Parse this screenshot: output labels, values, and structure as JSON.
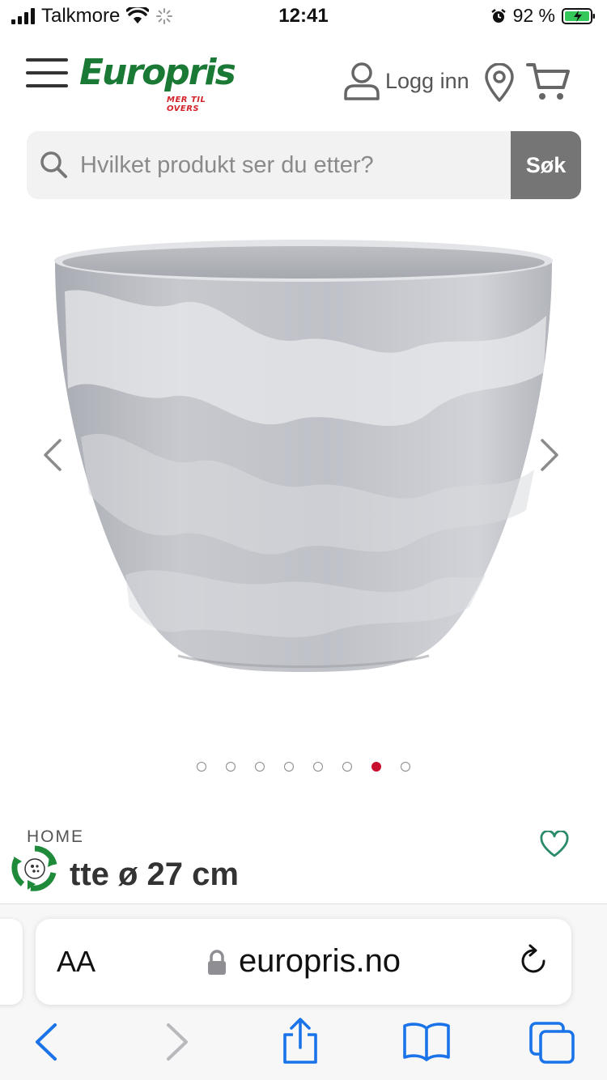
{
  "status_bar": {
    "carrier": "Talkmore",
    "time": "12:41",
    "battery": "92 %"
  },
  "header": {
    "logo_text": "Europris",
    "logo_tagline": "MER TIL OVERS",
    "login_label": "Logg inn",
    "brand_color": "#1a7a35",
    "accent_color": "#c8102e"
  },
  "search": {
    "placeholder": "Hvilket produkt ser du etter?",
    "button_label": "Søk"
  },
  "gallery": {
    "image_count": 8,
    "active_index": 6
  },
  "product": {
    "category": "HOME",
    "title": "tte ø 27 cm"
  },
  "browser": {
    "text_size_label": "AA",
    "url": "europris.no"
  },
  "icons": [
    "menu-icon",
    "user-icon",
    "location-pin-icon",
    "cart-icon",
    "search-icon",
    "chevron-left-icon",
    "chevron-right-icon",
    "heart-icon",
    "recycle-icon",
    "lock-icon",
    "reload-icon",
    "back-icon",
    "forward-icon",
    "share-icon",
    "bookmarks-icon",
    "tabs-icon"
  ]
}
